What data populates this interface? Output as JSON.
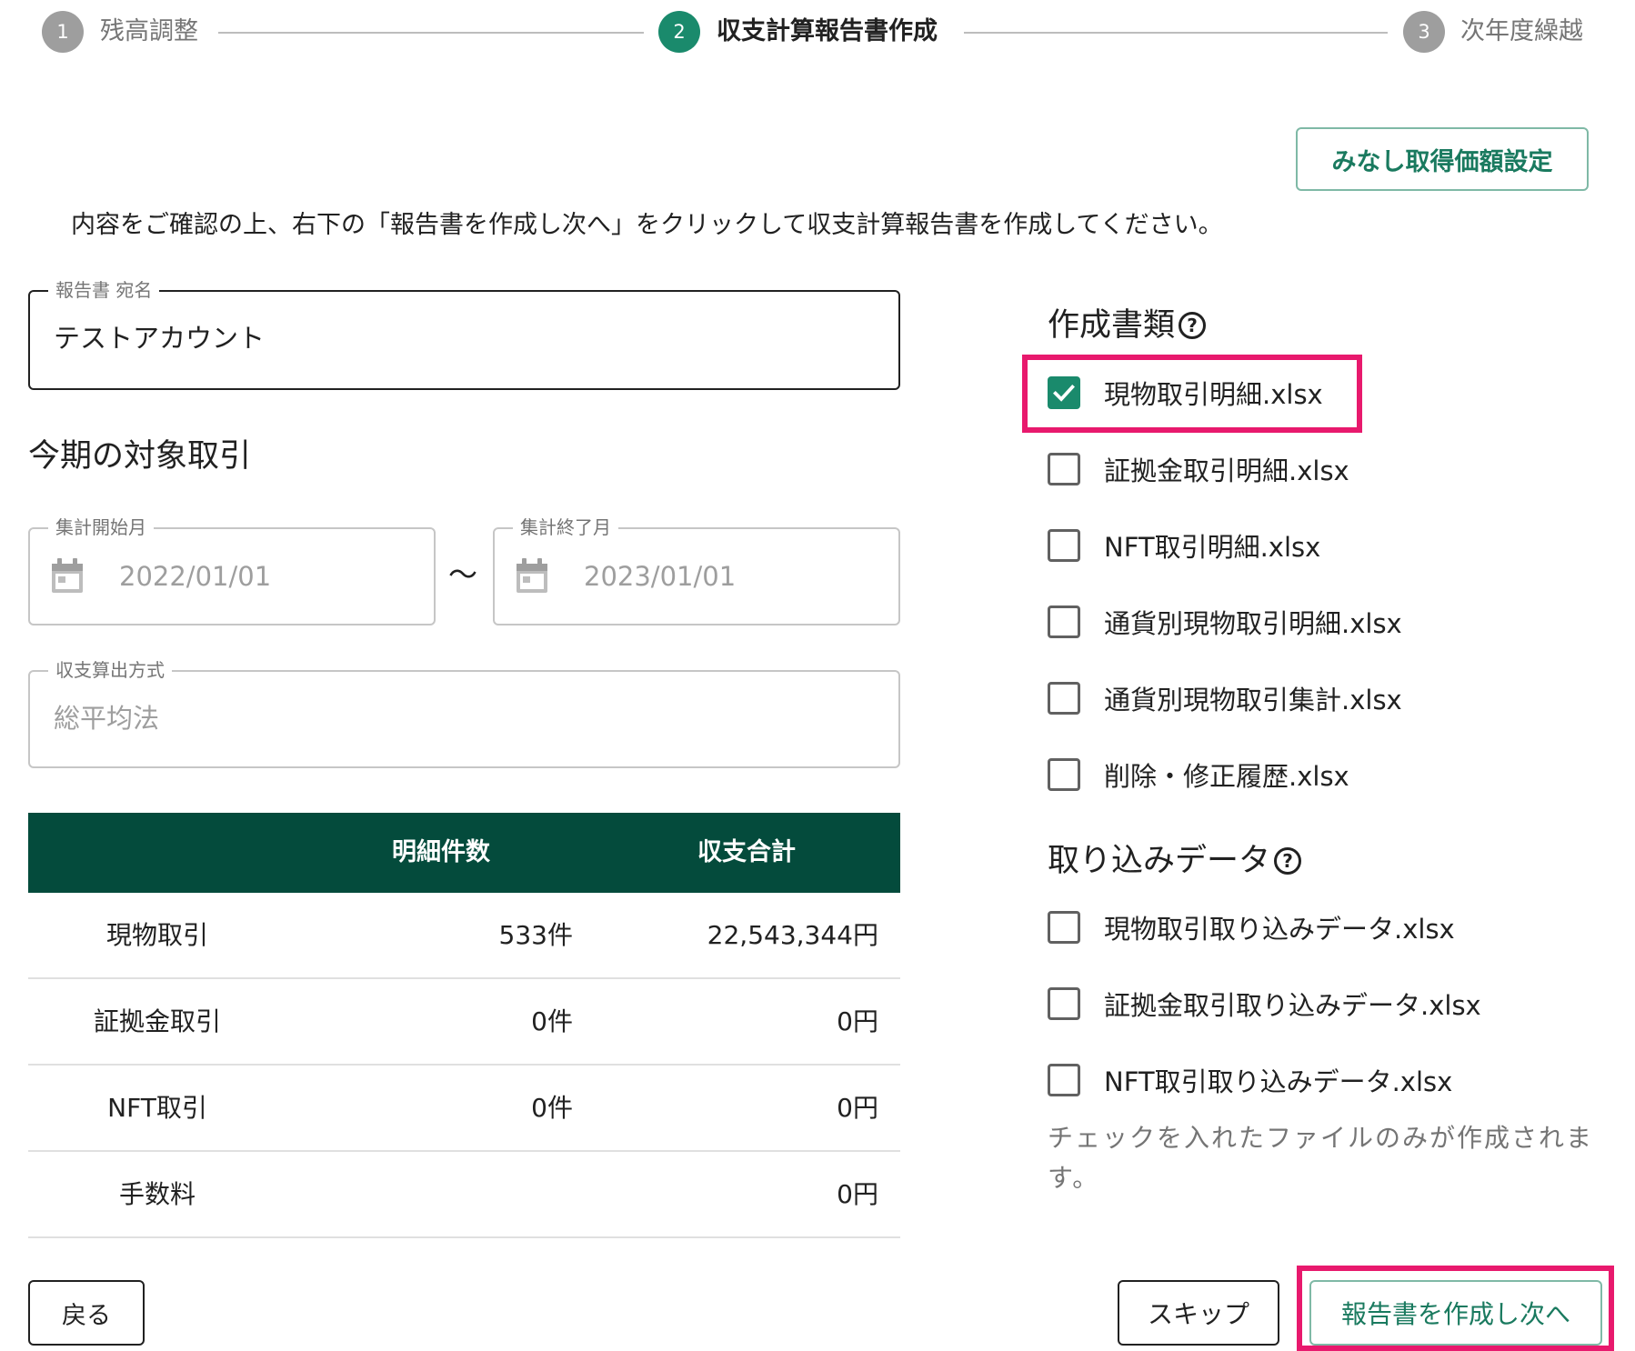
{
  "stepper": {
    "steps": [
      {
        "number": "1",
        "label": "残高調整"
      },
      {
        "number": "2",
        "label": "収支計算報告書作成"
      },
      {
        "number": "3",
        "label": "次年度繰越"
      }
    ]
  },
  "header": {
    "deemed_cost_button": "みなし取得価額設定",
    "instruction": "内容をご確認の上、右下の「報告書を作成し次へ」をクリックして収支計算報告書を作成してください。"
  },
  "report_addressee": {
    "legend": "報告書 宛名",
    "value": "テストアカウント"
  },
  "period_section": {
    "title": "今期の対象取引",
    "start": {
      "legend": "集計開始月",
      "value": "2022/01/01"
    },
    "separator": "〜",
    "end": {
      "legend": "集計終了月",
      "value": "2023/01/01"
    }
  },
  "calc_method": {
    "legend": "収支算出方式",
    "value": "総平均法"
  },
  "summary_table": {
    "headers": [
      "",
      "明細件数",
      "収支合計"
    ],
    "rows": [
      {
        "type": "現物取引",
        "count": "533件",
        "total": "22,543,344円"
      },
      {
        "type": "証拠金取引",
        "count": "0件",
        "total": "0円"
      },
      {
        "type": "NFT取引",
        "count": "0件",
        "total": "0円"
      },
      {
        "type": "手数料",
        "count": "",
        "total": "0円"
      }
    ]
  },
  "documents": {
    "title": "作成書類",
    "help_icon": "help-circle-icon",
    "items": [
      {
        "label": "現物取引明細.xlsx",
        "checked": true
      },
      {
        "label": "証拠金取引明細.xlsx",
        "checked": false
      },
      {
        "label": "NFT取引明細.xlsx",
        "checked": false
      },
      {
        "label": "通貨別現物取引明細.xlsx",
        "checked": false
      },
      {
        "label": "通貨別現物取引集計.xlsx",
        "checked": false
      },
      {
        "label": "削除・修正履歴.xlsx",
        "checked": false
      }
    ]
  },
  "import_data": {
    "title": "取り込みデータ",
    "help_icon": "help-circle-icon",
    "items": [
      {
        "label": "現物取引取り込みデータ.xlsx",
        "checked": false
      },
      {
        "label": "証拠金取引取り込みデータ.xlsx",
        "checked": false
      },
      {
        "label": "NFT取引取り込みデータ.xlsx",
        "checked": false
      }
    ],
    "note": "チェックを入れたファイルのみが作成されます。"
  },
  "footer": {
    "back": "戻る",
    "skip": "スキップ",
    "create_next": "報告書を作成し次へ"
  },
  "colors": {
    "primary_green": "#1a8a6c",
    "table_header": "#044b3c",
    "highlight_pink": "#e8196d"
  }
}
